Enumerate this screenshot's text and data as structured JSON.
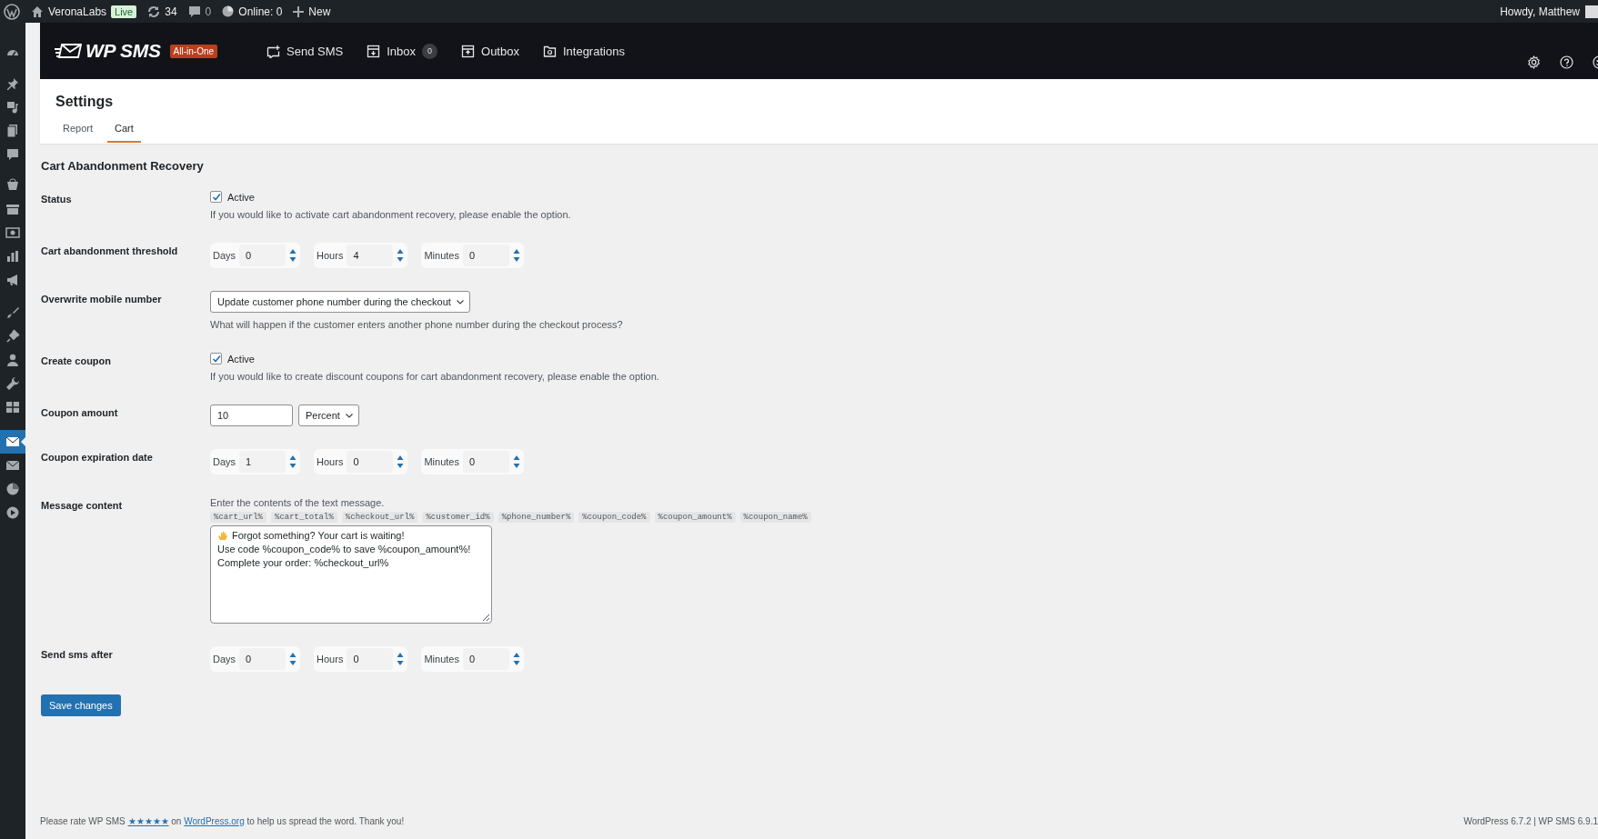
{
  "admin_bar": {
    "site": "VeronaLabs",
    "live_badge": "Live",
    "updates": "34",
    "comments": "0",
    "online": "Online: 0",
    "new": "New",
    "greeting": "Howdy, Matthew"
  },
  "sidebar": {
    "items": [
      {
        "selected": false
      },
      {
        "selected": false
      },
      {
        "selected": false
      },
      {
        "selected": false
      },
      {
        "selected": false
      },
      {
        "selected": false
      },
      {
        "selected": false
      },
      {
        "selected": false
      },
      {
        "selected": false
      },
      {
        "selected": false
      },
      {
        "selected": false
      },
      {
        "selected": false
      },
      {
        "selected": false
      },
      {
        "selected": false
      },
      {
        "selected": false
      },
      {
        "selected": true
      },
      {
        "selected": false
      },
      {
        "selected": false
      },
      {
        "selected": false
      }
    ]
  },
  "header": {
    "logo": "WP SMS",
    "edition": "All-in-One",
    "nav": [
      {
        "label": "Send SMS"
      },
      {
        "label": "Inbox",
        "badge": "0"
      },
      {
        "label": "Outbox"
      },
      {
        "label": "Integrations"
      }
    ]
  },
  "page": {
    "title": "Settings",
    "tabs": [
      {
        "label": "Report",
        "selected": false
      },
      {
        "label": "Cart",
        "selected": true
      }
    ]
  },
  "section_title": "Cart Abandonment Recovery",
  "fields": [
    {
      "kind": "checkbox",
      "label": "Status",
      "option": "Active",
      "checked": true,
      "description": "If you would like to activate cart abandonment recovery, please enable the option."
    },
    {
      "kind": "duration",
      "label": "Cart abandonment threshold",
      "parts": [
        {
          "unit": "Days",
          "value": "0"
        },
        {
          "unit": "Hours",
          "value": "4"
        },
        {
          "unit": "Minutes",
          "value": "0"
        }
      ]
    },
    {
      "kind": "select",
      "label": "Overwrite mobile number",
      "value": "Update customer phone number during the checkout",
      "description": "What will happen if the customer enters another phone number during the checkout process?"
    },
    {
      "kind": "checkbox",
      "label": "Create coupon",
      "option": "Active",
      "checked": true,
      "description": "If you would like to create discount coupons for cart abandonment recovery, please enable the option."
    },
    {
      "kind": "amount",
      "label": "Coupon amount",
      "value": "10",
      "unit": "Percent"
    },
    {
      "kind": "duration",
      "label": "Coupon expiration date",
      "parts": [
        {
          "unit": "Days",
          "value": "1"
        },
        {
          "unit": "Hours",
          "value": "0"
        },
        {
          "unit": "Minutes",
          "value": "0"
        }
      ]
    },
    {
      "kind": "message",
      "label": "Message content",
      "hint": "Enter the contents of the text message.",
      "tags": [
        "%cart_url%",
        "%cart_total%",
        "%checkout_url%",
        "%customer_id%",
        "%phone_number%",
        "%coupon_code%",
        "%coupon_amount%",
        "%coupon_name%"
      ],
      "lines": [
        "Forgot something? Your cart is waiting!",
        "Use code %coupon_code% to save %coupon_amount%!",
        "Complete your order: %checkout_url%"
      ]
    },
    {
      "kind": "duration",
      "label": "Send sms after",
      "parts": [
        {
          "unit": "Days",
          "value": "0"
        },
        {
          "unit": "Hours",
          "value": "0"
        },
        {
          "unit": "Minutes",
          "value": "0"
        }
      ]
    }
  ],
  "save_button": "Save changes",
  "footer": {
    "before": "Please rate WP SMS",
    "stars": "★★★★★",
    "middle": "on",
    "link": "WordPress.org",
    "after": "to help us spread the word. Thank you!",
    "version": "WordPress 6.7.2 | WP SMS 6.9.1"
  }
}
